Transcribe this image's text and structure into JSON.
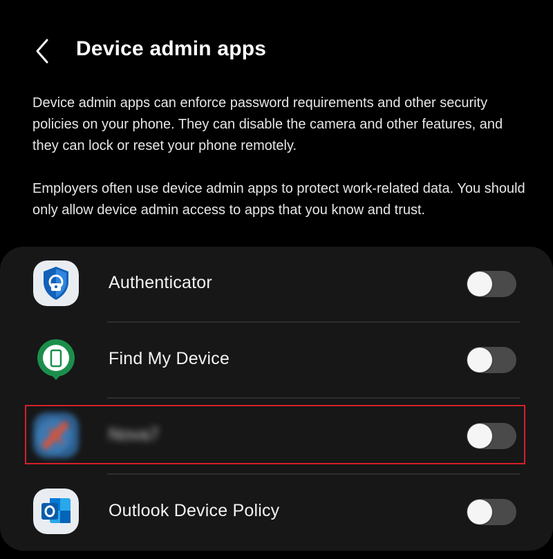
{
  "header": {
    "title": "Device admin apps",
    "back_icon": "chevron-left-icon"
  },
  "description": {
    "paragraph_1": "Device admin apps can enforce password requirements and other security policies on your phone. They can disable the camera and other features, and they can lock or reset your phone remotely.",
    "paragraph_2": "Employers often use device admin apps to protect work-related data. You should only allow device admin access to apps that you know and trust."
  },
  "apps": [
    {
      "label": "Authenticator",
      "icon": "authenticator-icon",
      "enabled": false
    },
    {
      "label": "Find My Device",
      "icon": "find-my-device-icon",
      "enabled": false
    },
    {
      "label": "Nova7",
      "icon": "blurred-app-icon",
      "enabled": false,
      "blurred": true
    },
    {
      "label": "Outlook Device Policy",
      "icon": "outlook-icon",
      "enabled": false
    }
  ],
  "colors": {
    "background": "#000000",
    "card": "#171717",
    "toggle_off_track": "#4a4a4a",
    "highlight": "#d4202a"
  }
}
